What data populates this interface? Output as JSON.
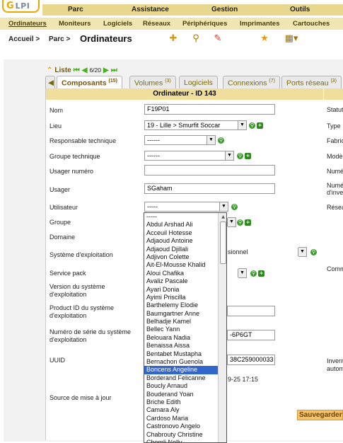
{
  "logo": {
    "g": "G",
    "text": "LPI"
  },
  "top_menu": [
    "Parc",
    "Assistance",
    "Gestion",
    "Outils"
  ],
  "sub_menu": [
    "Ordinateurs",
    "Moniteurs",
    "Logiciels",
    "Réseaux",
    "Périphériques",
    "Imprimantes",
    "Cartouches"
  ],
  "breadcrumb": {
    "home": "Accueil >",
    "parc": "Parc >",
    "title": "Ordinateurs"
  },
  "list_nav": {
    "label": "Liste",
    "position": "6/20"
  },
  "tabs": [
    {
      "label": "Composants",
      "count": "(15)"
    },
    {
      "label": "Volumes",
      "count": "(3)"
    },
    {
      "label": "Logiciels",
      "count": ""
    },
    {
      "label": "Connexions",
      "count": "(7)"
    },
    {
      "label": "Ports réseau",
      "count": "(3)"
    }
  ],
  "form": {
    "header": "Ordinateur - ID 143",
    "labels": {
      "nom": "Nom",
      "lieu": "Lieu",
      "resp_tech": "Responsable technique",
      "groupe_tech": "Groupe technique",
      "usager_num": "Usager numéro",
      "usager": "Usager",
      "utilisateur": "Utilisateur",
      "groupe": "Groupe",
      "domaine": "Domaine",
      "os": "Système d'exploitation",
      "sp": "Service pack",
      "os_version": "Version du système d'exploitation",
      "product_id": "Product ID du système d'exploitation",
      "serial": "Numéro de série du système d'exploitation",
      "uuid": "UUID",
      "source": "Source de mise à jour"
    },
    "values": {
      "nom": "F19P01",
      "lieu": "19 - Lille > Smurfit Soccar",
      "resp_tech": "------",
      "groupe_tech": "------",
      "usager_num": "",
      "usager": "SGaham",
      "utilisateur": "-----",
      "os_partial": "sionnel",
      "serial_partial": "-6P6GT",
      "uuid_partial": "38C259000033",
      "date_partial": "9-25 17:15"
    },
    "right_labels": {
      "statut": "Statut",
      "type": "Type",
      "fabricant": "Fabric",
      "modele": "Modèl",
      "numero": "Numé",
      "num_inv_1": "Numé",
      "num_inv_2": "d'inve",
      "reseau": "Résea",
      "comm": "Comm",
      "invent_1": "Invent",
      "invent_2": "autom"
    },
    "save_label": "Sauvegarder"
  },
  "user_dropdown": {
    "options": [
      "-----",
      "Abdul Arshad Ali",
      "Acceuil Hotesse",
      "Adjaoud Antoine",
      "Adjaoud Djillali",
      "Adjivon Colette",
      "Ait-El-Mousse Khalid",
      "Aloui Chafika",
      "Avaliz Pascale",
      "Ayari Donia",
      "Ayimi Priscilla",
      "Barthelemy Elodie",
      "Baumgartner Anne",
      "Belhadje Kamel",
      "Bellec Yann",
      "Belouara Nadia",
      "Benaissa Aissa",
      "Bentabet Mustapha",
      "Bernachon Guenola",
      "Boncens Angeline",
      "Borderand Felicanne",
      "Boucly Arnaud",
      "Bouderand Yoan",
      "Briche Edith",
      "Camara Aly",
      "Cardoso Maria",
      "Castronovo Angelo",
      "Chabrouty Christine",
      "Chemli Nelly"
    ],
    "selected": "Boncens Angeline"
  }
}
